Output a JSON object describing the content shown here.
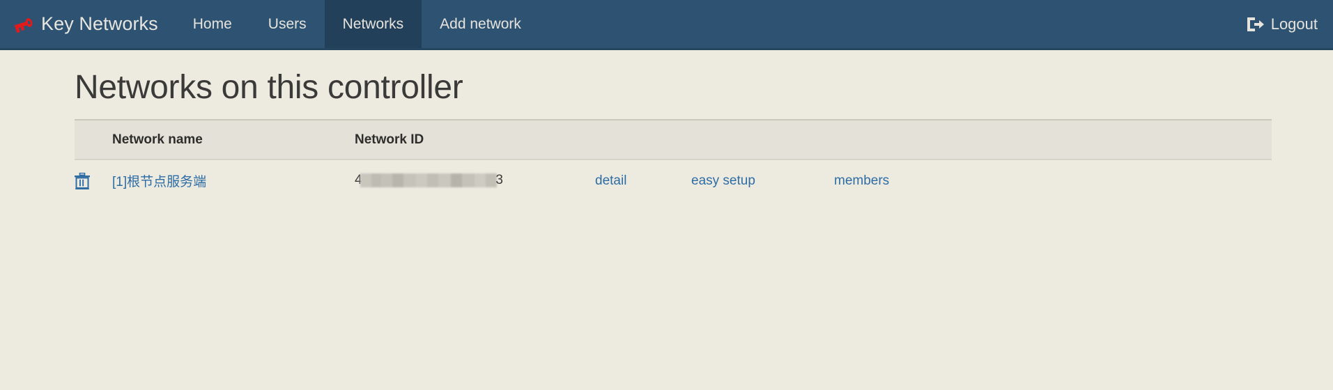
{
  "navbar": {
    "brand": "Key Networks",
    "brand_icon": "key-icon",
    "items": [
      {
        "label": "Home",
        "active": false
      },
      {
        "label": "Users",
        "active": false
      },
      {
        "label": "Networks",
        "active": true
      },
      {
        "label": "Add network",
        "active": false
      }
    ],
    "logout": {
      "label": "Logout",
      "icon": "sign-out-icon"
    },
    "background_color": "#2e5372",
    "active_item_color": "#23405a",
    "text_color": "#e6e4dd",
    "brand_icon_color": "#e11b1b"
  },
  "page": {
    "title": "Networks on this controller",
    "background_color": "#edeae0"
  },
  "table": {
    "headers": [
      "Network name",
      "Network ID",
      "",
      "",
      ""
    ],
    "header_background": "#e4e2d8",
    "rows": [
      {
        "delete_icon": "trash-icon",
        "network_name": "[1]根节点服务端",
        "network_id_redacted": true,
        "network_id_visible_prefix": "4",
        "network_id_visible_suffix": "3",
        "actions": [
          {
            "label": "detail"
          },
          {
            "label": "easy setup"
          },
          {
            "label": "members"
          }
        ]
      }
    ],
    "link_color": "#2e6da4"
  }
}
